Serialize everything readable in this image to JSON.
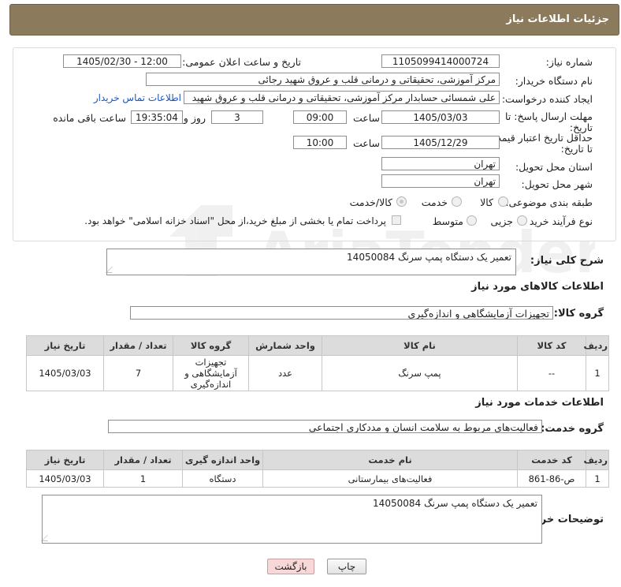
{
  "header": {
    "title": "جزئیات اطلاعات نیاز"
  },
  "need_number": {
    "label": "شماره نیاز:",
    "value": "1105099414000724"
  },
  "announce_datetime": {
    "label": "تاریخ و ساعت اعلان عمومی:",
    "value": "1405/02/30 - 12:00"
  },
  "buyer_org": {
    "label": "نام دستگاه خریدار:",
    "value": "مرکز آموزشی، تحقیقاتی و درمانی قلب و عروق شهید رجائی"
  },
  "requester": {
    "label": "ایجاد کننده درخواست:",
    "value": "علی شمسائی حسابدار مرکز آموزشی، تحقیقاتی و درمانی قلب و عروق شهید",
    "contact_link": "اطلاعات تماس خریدار"
  },
  "reply_deadline": {
    "label_line1": "مهلت ارسال پاسخ: تا",
    "label_line2": "تاریخ:",
    "date": "1405/03/03",
    "time_label": "ساعت",
    "time": "09:00",
    "days": "3",
    "days_label": "روز و",
    "remaining": "19:35:04",
    "remaining_label": "ساعت باقی مانده"
  },
  "price_validity": {
    "label_line1": "حداقل تاریخ اعتبار قیمت:",
    "label_line2": "تا تاریخ:",
    "date": "1405/12/29",
    "time_label": "ساعت",
    "time": "10:00"
  },
  "delivery_province": {
    "label": "استان محل تحویل:",
    "value": "تهران"
  },
  "delivery_city": {
    "label": "شهر محل تحویل:",
    "value": "تهران"
  },
  "category": {
    "label": "طبقه بندی موضوعی:",
    "options": [
      "کالا",
      "خدمت",
      "کالا/خدمت"
    ],
    "selected": "کالا/خدمت"
  },
  "purchase_process": {
    "label": "نوع فرآیند خرید :",
    "options": [
      "جزیی",
      "متوسط"
    ],
    "payment_note": "پرداخت تمام یا بخشی از مبلغ خرید،از محل \"اسناد خزانه اسلامی\" خواهد بود."
  },
  "summary": {
    "label": "شرح کلی نیاز:",
    "value": "تعمیر یک دستگاه پمپ سرنگ 14050084"
  },
  "goods": {
    "section_title": "اطلاعات کالاهای مورد نیاز",
    "group_label": "گروه کالا:",
    "group_value": "تجهیزات آزمایشگاهی و اندازه‌گیری",
    "columns": [
      "ردیف",
      "کد کالا",
      "نام کالا",
      "واحد شمارش",
      "گروه کالا",
      "تعداد / مقدار",
      "تاریخ نیاز"
    ],
    "rows": [
      {
        "row": "1",
        "code": "--",
        "name": "پمپ سرنگ",
        "unit": "عدد",
        "group_l1": "تجهیزات",
        "group_l2": "آزمایشگاهی و",
        "group_l3": "اندازه‌گیری",
        "qty": "7",
        "date": "1405/03/03"
      }
    ]
  },
  "services": {
    "section_title": "اطلاعات خدمات مورد نیاز",
    "group_label": "گروه خدمت:",
    "group_value": "فعالیت‌های مربوط به سلامت انسان و مددکاری اجتماعی",
    "columns": [
      "ردیف",
      "کد خدمت",
      "نام خدمت",
      "واحد اندازه گیری",
      "تعداد / مقدار",
      "تاریخ نیاز"
    ],
    "rows": [
      {
        "row": "1",
        "code": "ص-86-861",
        "name": "فعالیت‌های بیمارستانی",
        "unit": "دستگاه",
        "qty": "1",
        "date": "1405/03/03"
      }
    ]
  },
  "buyer_notes": {
    "label": "توضیحات خریدار:",
    "value": "تعمیر یک دستگاه پمپ سرنگ 14050084"
  },
  "buttons": {
    "print": "چاپ",
    "back": "بازگشت"
  },
  "watermark": {
    "text": "AriaTender.net"
  },
  "colors": {
    "header_bg": "#8b7b5c",
    "table_header_bg": "#dcdcdc",
    "link": "#1a56c4",
    "back_button_bg": "#f7d7d7"
  }
}
